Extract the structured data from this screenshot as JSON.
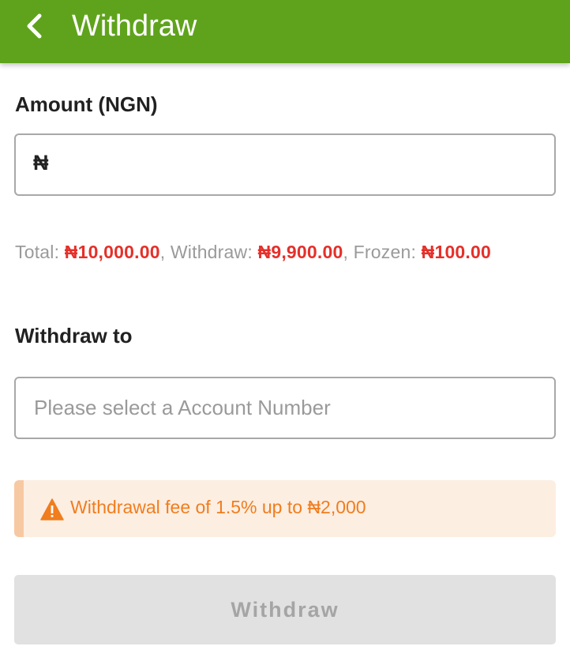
{
  "header": {
    "title": "Withdraw",
    "back_icon": "chevron-left-icon",
    "color": "#5fa31c"
  },
  "amount": {
    "label": "Amount (NGN)",
    "currency_symbol": "₦",
    "value": ""
  },
  "balances": {
    "total_label": "Total: ",
    "total_value": "₦10,000.00",
    "withdraw_label": ", Withdraw: ",
    "withdraw_value": "₦9,900.00",
    "frozen_label": ", Frozen: ",
    "frozen_value": "₦100.00",
    "value_color": "#e5302a"
  },
  "withdraw_to": {
    "label": "Withdraw to",
    "placeholder": "Please select a Account Number"
  },
  "notice": {
    "icon": "warning-icon",
    "text": "Withdrawal fee of 1.5% up to ₦2,000",
    "color": "#f07d1e"
  },
  "submit": {
    "label": "Withdraw",
    "disabled": true
  }
}
